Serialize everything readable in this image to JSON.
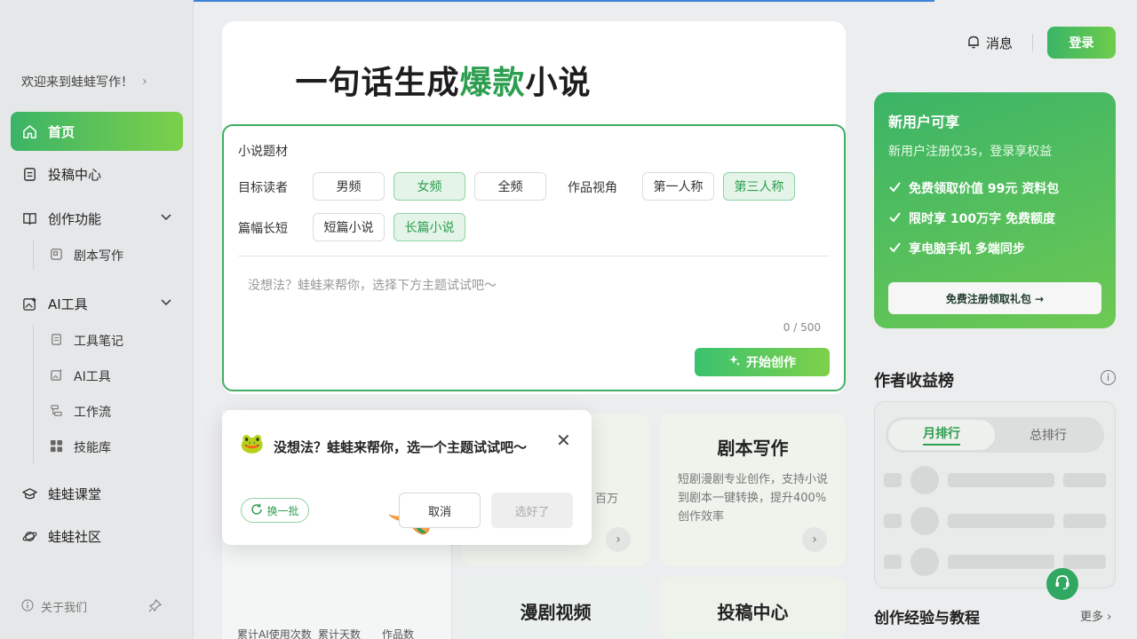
{
  "sidebar": {
    "welcome": "欢迎来到蛙蛙写作！",
    "items": [
      {
        "label": "首页"
      },
      {
        "label": "投稿中心"
      },
      {
        "label": "创作功能"
      },
      {
        "label": "AI工具"
      },
      {
        "label": "蛙蛙课堂"
      },
      {
        "label": "蛙蛙社区"
      }
    ],
    "creation_sub": [
      {
        "label": "剧本写作"
      }
    ],
    "ai_sub": [
      {
        "label": "工具笔记"
      },
      {
        "label": "AI工具"
      },
      {
        "label": "工作流"
      },
      {
        "label": "技能库"
      }
    ],
    "about": "关于我们"
  },
  "hero": {
    "title_pre": "一句话生成",
    "title_hl": "爆款",
    "title_post": "小说"
  },
  "form": {
    "section_label": "小说题材",
    "reader_label": "目标读者",
    "reader_options": [
      "男频",
      "女频",
      "全频"
    ],
    "reader_selected": "女频",
    "view_label": "作品视角",
    "view_options": [
      "第一人称",
      "第三人称"
    ],
    "view_selected": "第三人称",
    "length_label": "篇幅长短",
    "length_options": [
      "短篇小说",
      "长篇小说"
    ],
    "length_selected": "长篇小说",
    "placeholder": "没想法？蛙蛙来帮你，选择下方主题试试吧～",
    "counter": "0 / 500",
    "start_button": "开始创作"
  },
  "cards": [
    {
      "title": "剧本写作",
      "desc": "短剧漫剧专业创作，支持小说到剧本一键转换，提升400%创作效率"
    },
    {
      "title": "漫剧视频"
    },
    {
      "title": "投稿中心"
    }
  ],
  "hidden_card_fragment": "百万",
  "stats": {
    "labels": [
      "累计AI使用次数",
      "累计天数",
      "作品数"
    ]
  },
  "dialog": {
    "title": "没想法？蛙蛙来帮你，选一个主题试试吧～",
    "refresh": "换一批",
    "cancel": "取消",
    "confirm": "选好了"
  },
  "header": {
    "messages": "消息",
    "login": "登录"
  },
  "promo": {
    "title": "新用户可享",
    "subtitle": "新用户注册仅3s，登录享权益",
    "benefits": [
      "免费领取价值 99元 资料包",
      "限时享 100万字 免费额度",
      "享电脑手机 多端同步"
    ],
    "button": "免费注册领取礼包 →"
  },
  "ranking": {
    "title": "作者收益榜",
    "tabs": [
      "月排行",
      "总排行"
    ],
    "active_tab": "月排行"
  },
  "tutorials": {
    "title": "创作经验与教程",
    "more": "更多"
  },
  "colors": {
    "brand_green": "#3bb467",
    "accent_text": "#2e9e50",
    "progress_bar": "#3b82d8"
  }
}
